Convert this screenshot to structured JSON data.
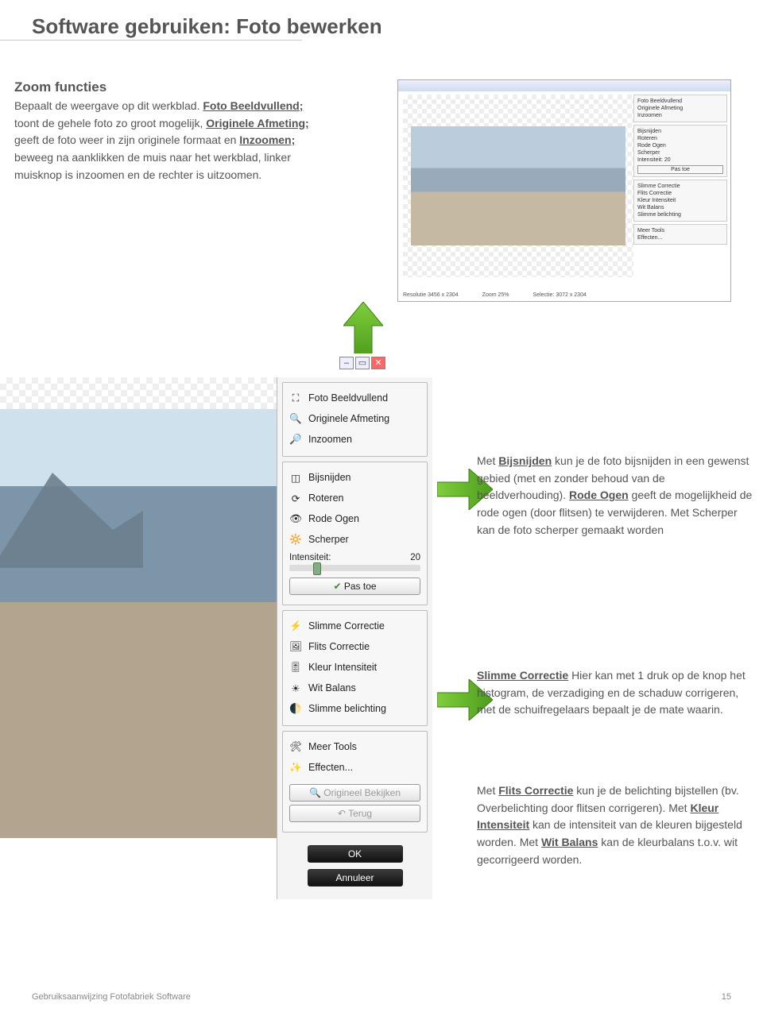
{
  "page": {
    "title": "Software gebruiken: Foto bewerken",
    "footer_left": "Gebruiksaanwijzing Fotofabriek Software",
    "footer_page": "15"
  },
  "zoom": {
    "heading": "Zoom functies",
    "p1a": "Bepaalt de weergave op dit werkblad. ",
    "p1b": "Foto Beeldvullend;",
    "p1c": " toont de gehele foto zo groot mogelijk, ",
    "p1d": "Originele Afmeting;",
    "p1e": " geeft de foto weer in zijn originele formaat en ",
    "p1f": "Inzoomen;",
    "p1g": " beweeg na aanklikken de muis naar het werkblad, linker muisknop is inzoomen en de rechter is uitzoomen."
  },
  "mini": {
    "items_a": [
      "Foto Beeldvullend",
      "Originele Afmeting",
      "Inzoomen"
    ],
    "items_b": [
      "Bijsnijden",
      "Roteren",
      "Rode Ogen",
      "Scherper"
    ],
    "items_c": [
      "Slimme Correctie",
      "Flits Correctie",
      "Kleur Intensiteit",
      "Wit Balans",
      "Slimme belichting"
    ],
    "items_d": [
      "Meer Tools",
      "Effecten..."
    ],
    "status_res": "Resolutie 3456 x 2304",
    "status_zoom": "Zoom 25%",
    "status_sel": "Selectie: 3072 x 2304",
    "intensiteit_label": "Intensiteit:",
    "intensiteit_val": "20",
    "pastoe": "Pas toe"
  },
  "sidebar": {
    "g1": {
      "i0": "Foto Beeldvullend",
      "i1": "Originele Afmeting",
      "i2": "Inzoomen"
    },
    "g2": {
      "i0": "Bijsnijden",
      "i1": "Roteren",
      "i2": "Rode Ogen",
      "i3": "Scherper",
      "intensiteit_label": "Intensiteit:",
      "intensiteit_val": "20",
      "apply": "Pas toe"
    },
    "g3": {
      "i0": "Slimme Correctie",
      "i1": "Flits Correctie",
      "i2": "Kleur Intensiteit",
      "i3": "Wit Balans",
      "i4": "Slimme belichting"
    },
    "g4": {
      "i0": "Meer Tools",
      "i1": "Effecten..."
    },
    "btn_orig": "Origineel Bekijken",
    "btn_undo": "Terug",
    "btn_ok": "OK",
    "btn_cancel": "Annuleer"
  },
  "explain1": {
    "a": "Met ",
    "b": "Bijsnijden",
    "c": " kun je de foto bijsnijden in een gewenst gebied (met en zonder behoud van de beeldverhouding). ",
    "d": "Rode Ogen",
    "e": " geeft de mogelijkheid de rode ogen (door flitsen) te verwijderen. Met Scherper kan de foto scherper gemaakt worden"
  },
  "explain2": {
    "a": "Slimme Correctie",
    "b": " Hier kan met 1 druk op de knop het histogram, de verzadiging en de schaduw corrigeren, met de schuifregelaars bepaalt je de mate waarin."
  },
  "explain3": {
    "a": "Met ",
    "b": "Flits Correctie",
    "c": " kun je de belichting bijstellen (bv. Overbelichting door flitsen corrigeren). Met ",
    "d": "Kleur Intensiteit",
    "e": " kan de intensiteit van de kleuren bijgesteld worden. Met ",
    "f": "Wit Balans",
    "g": " kan de kleurbalans t.o.v. wit gecorrigeerd worden."
  }
}
